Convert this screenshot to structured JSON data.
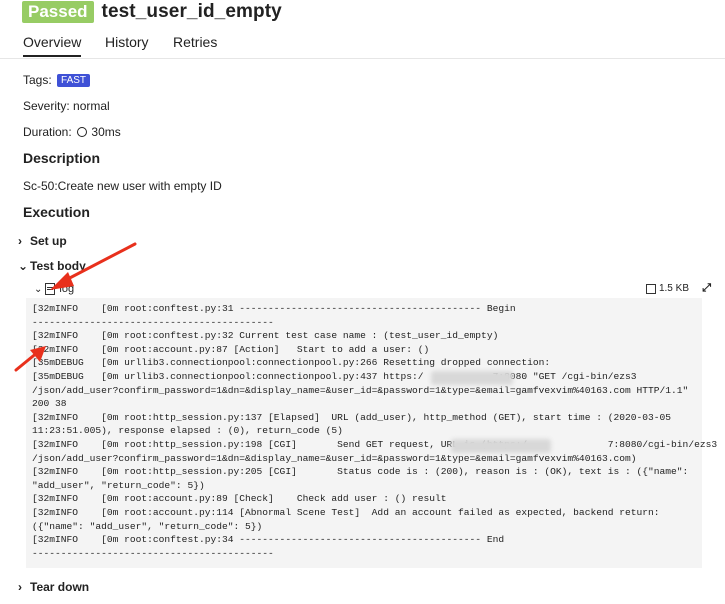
{
  "header": {
    "status": "Passed",
    "title": "test_user_id_empty"
  },
  "tabs": [
    {
      "label": "Overview"
    },
    {
      "label": "History"
    },
    {
      "label": "Retries"
    }
  ],
  "info": {
    "tags_label": "Tags:",
    "tag": "FAST",
    "severity": "Severity: normal",
    "duration_label": "Duration:",
    "duration": "30ms"
  },
  "description": {
    "heading": "Description",
    "text": "Sc-50:Create new user with empty ID"
  },
  "execution": {
    "heading": "Execution",
    "setup": "Set up",
    "test_body": "Test body",
    "attachment": {
      "name": "log",
      "size": "1.5 KB"
    },
    "teardown": "Tear down"
  },
  "log": {
    "lines": [
      "[32mINFO    [0m root:conftest.py:31 ------------------------------------------ Begin",
      "------------------------------------------",
      "[32mINFO    [0m root:conftest.py:32 Current test case name : (test_user_id_empty)",
      "[32mINFO    [0m root:account.py:87 [Action]   Start to add a user: ()",
      "[35mDEBUG   [0m urllib3.connectionpool:connectionpool.py:266 Resetting dropped connection:",
      "[35mDEBUG   [0m urllib3.connectionpool:connectionpool.py:437 https:/            7:8080 \"GET /cgi-bin/ezs3",
      "/json/add_user?confirm_password=1&dn=&display_name=&user_id=&password=1&type=&email=gamfvexvim%40163.com HTTP/1.1\"",
      "200 38",
      "[32mINFO    [0m root:http_session.py:137 [Elapsed]  URL (add_user), http_method (GET), start time : (2020-03-05",
      "11:23:51.005), response elapsed : (0), return_code (5)",
      "[32mINFO    [0m root:http_session.py:198 [CGI]       Send GET request, URL is (https:/              7:8080/cgi-bin/ezs3",
      "/json/add_user?confirm_password=1&dn=&display_name=&user_id=&password=1&type=&email=gamfvexvim%40163.com)",
      "[32mINFO    [0m root:http_session.py:205 [CGI]       Status code is : (200), reason is : (OK), text is : ({\"name\":",
      "\"add_user\", \"return_code\": 5})",
      "[32mINFO    [0m root:account.py:89 [Check]    Check add user : () result",
      "[32mINFO    [0m root:account.py:114 [Abnormal Scene Test]  Add an account failed as expected, backend return:",
      "({\"name\": \"add_user\", \"return_code\": 5})",
      "[32mINFO    [0m root:conftest.py:34 ------------------------------------------ End",
      "------------------------------------------"
    ]
  },
  "colors": {
    "passed": "#97cc64",
    "tag": "#3f51d6",
    "annotation": "#e8301c"
  }
}
